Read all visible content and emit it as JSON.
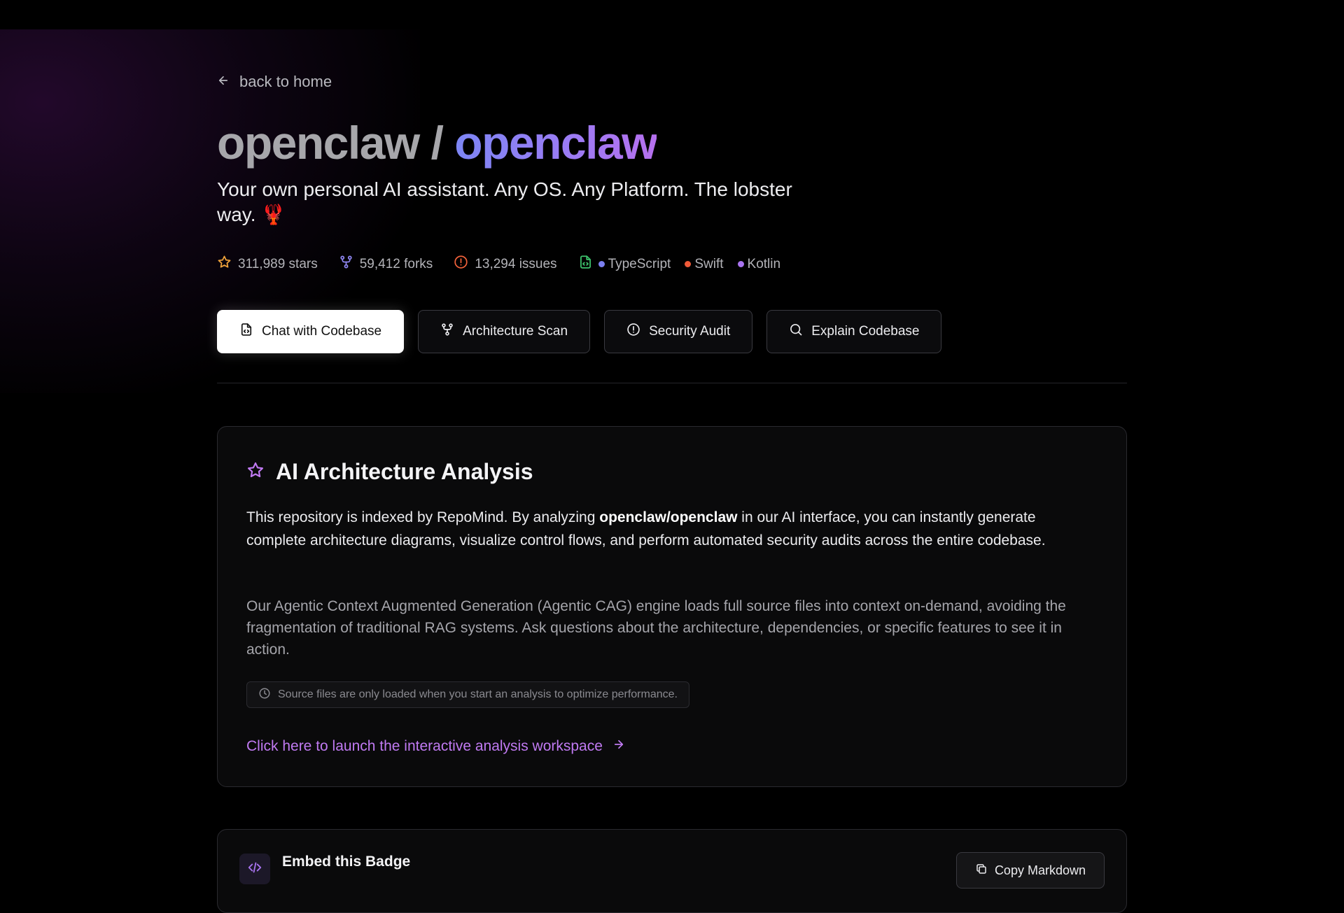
{
  "nav": {
    "back_label": "back to home"
  },
  "repo": {
    "owner": "openclaw",
    "separator": " / ",
    "name": "openclaw",
    "description": "Your own personal AI assistant. Any OS. Any Platform. The lobster way. 🦞"
  },
  "stats": {
    "stars": "311,989 stars",
    "forks": "59,412 forks",
    "issues": "13,294 issues",
    "languages": [
      {
        "name": "TypeScript",
        "color": "#7b7ff0"
      },
      {
        "name": "Swift",
        "color": "#f05a38"
      },
      {
        "name": "Kotlin",
        "color": "#a974f0"
      }
    ]
  },
  "actions": {
    "chat": "Chat with Codebase",
    "architecture": "Architecture Scan",
    "security": "Security Audit",
    "explain": "Explain Codebase"
  },
  "analysis": {
    "title": "AI Architecture Analysis",
    "p1_before": "This repository is indexed by RepoMind. By analyzing ",
    "p1_repo": "openclaw/openclaw",
    "p1_after": " in our AI interface, you can instantly generate complete architecture diagrams, visualize control flows, and perform automated security audits across the entire codebase.",
    "p2": "Our Agentic Context Augmented Generation (Agentic CAG) engine loads full source files into context on-demand, avoiding the fragmentation of traditional RAG systems. Ask questions about the architecture, dependencies, or specific features to see it in action.",
    "notice": "Source files are only loaded when you start an analysis to optimize performance.",
    "launch_label": "Click here to launch the interactive analysis workspace"
  },
  "badge": {
    "title": "Embed this Badge",
    "copy_label": "Copy Markdown"
  },
  "colors": {
    "accent": "#c07af2",
    "title_gradient_start": "#7d86f5",
    "title_gradient_end": "#b670ee",
    "star_icon": "#f2a33a",
    "fork_icon": "#8f86f2",
    "issue_icon": "#f0613a",
    "file_icon": "#3ec46d"
  }
}
